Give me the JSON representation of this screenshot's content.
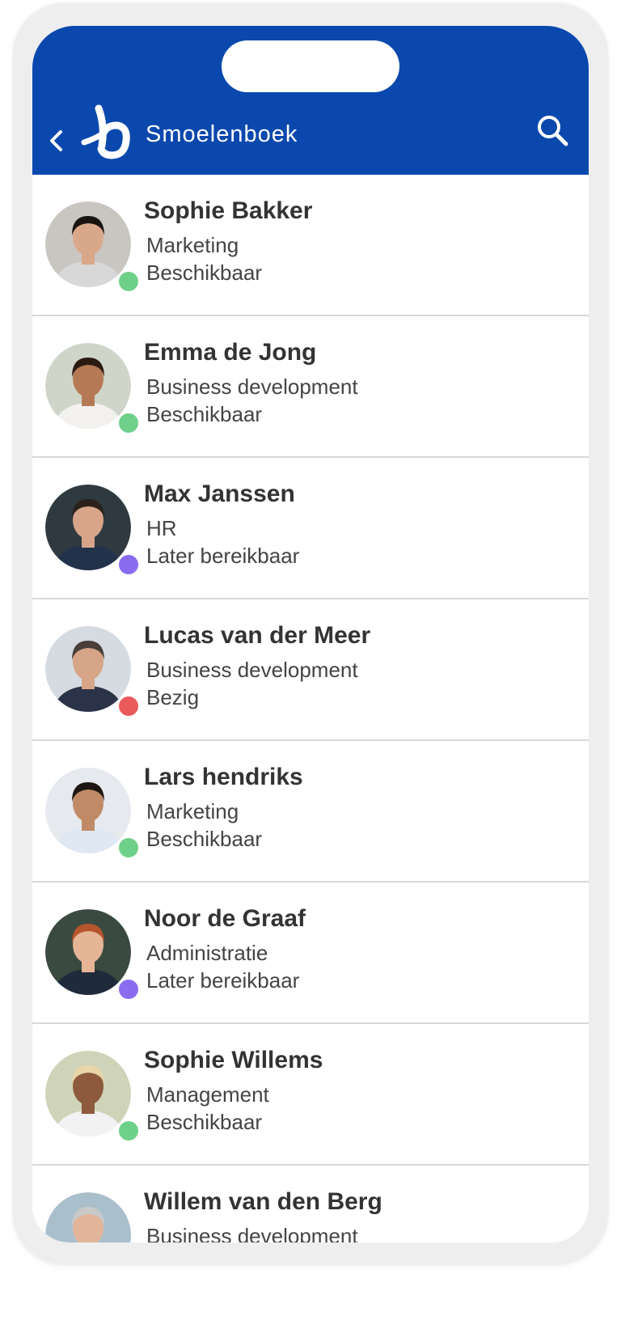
{
  "header": {
    "title": "Smoelenboek",
    "back_icon": "chevron-left-icon",
    "search_icon": "search-icon",
    "logo": "b",
    "background": "#0a48ae"
  },
  "status_colors": {
    "available": "#6fd08a",
    "later": "#8a6cf0",
    "busy": "#ea5a5a"
  },
  "people": [
    {
      "name": "Sophie Bakker",
      "department": "Marketing",
      "status": "Beschikbaar",
      "status_key": "available",
      "skin": "#d9a88a",
      "hair": "#1a1410",
      "shirt": "#d8d8d8",
      "bg": "#c9c6c1"
    },
    {
      "name": "Emma de Jong",
      "department": "Business development",
      "status": "Beschikbaar",
      "status_key": "available",
      "skin": "#b57a55",
      "hair": "#2a1a12",
      "shirt": "#f3f1ee",
      "bg": "#cfd6c9"
    },
    {
      "name": "Max Janssen",
      "department": "HR",
      "status": "Later bereikbaar",
      "status_key": "later",
      "skin": "#d8a58a",
      "hair": "#2b211b",
      "shirt": "#22324a",
      "bg": "#2f3a40"
    },
    {
      "name": "Lucas van der Meer",
      "department": "Business development",
      "status": "Bezig",
      "status_key": "busy",
      "skin": "#d6a486",
      "hair": "#4a3f38",
      "shirt": "#2a3348",
      "bg": "#d5dbe1"
    },
    {
      "name": "Lars hendriks",
      "department": "Marketing",
      "status": "Beschikbaar",
      "status_key": "available",
      "skin": "#c08a66",
      "hair": "#1d1611",
      "shirt": "#dfe8f3",
      "bg": "#e6e9ee"
    },
    {
      "name": "Noor de Graaf",
      "department": "Administratie",
      "status": "Later bereikbaar",
      "status_key": "later",
      "skin": "#e5b596",
      "hair": "#b4552c",
      "shirt": "#1f2a3a",
      "bg": "#3a4a40"
    },
    {
      "name": "Sophie Willems",
      "department": "Management",
      "status": "Beschikbaar",
      "status_key": "available",
      "skin": "#8d5a3e",
      "hair": "#e8d6a8",
      "shirt": "#f2f2f2",
      "bg": "#cfd3b8"
    },
    {
      "name": "Willem van den Berg",
      "department": "Business development",
      "status": "",
      "status_key": "",
      "skin": "#e2b49a",
      "hair": "#c9c9c9",
      "shirt": "#3b4a5c",
      "bg": "#a9c0cc"
    }
  ]
}
